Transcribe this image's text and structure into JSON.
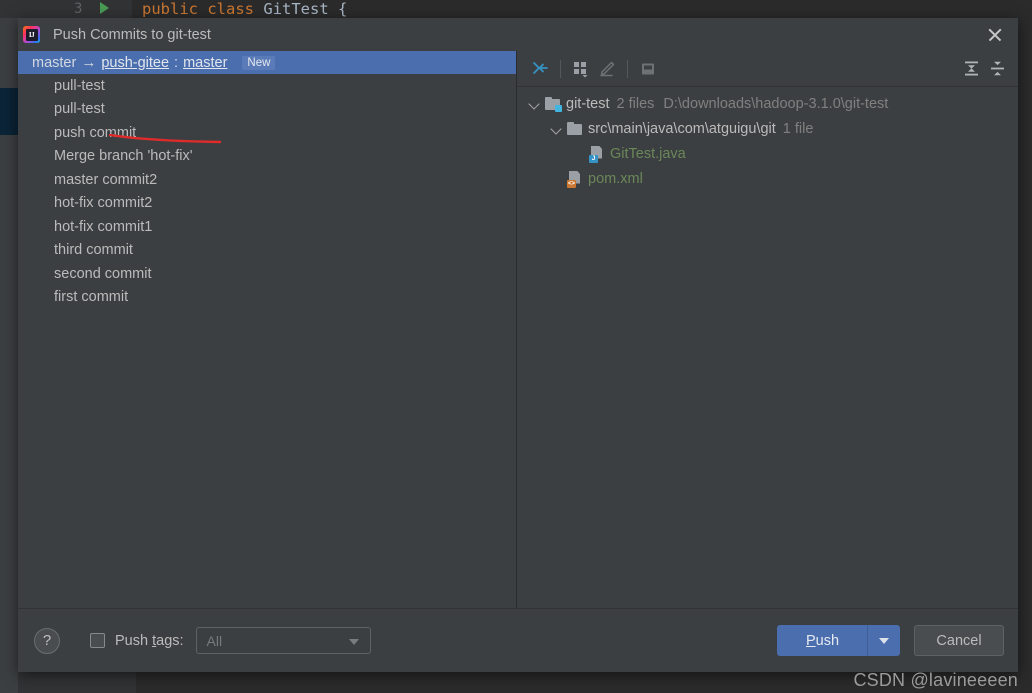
{
  "background": {
    "code_line": {
      "line_number": "3",
      "keyword1": "public",
      "keyword2": "class",
      "class_name": "GitTest",
      "brace": "{"
    }
  },
  "dialog": {
    "title": "Push Commits to git-test",
    "app_icon_text": "IJ",
    "close_label": "×"
  },
  "commits_pane": {
    "branch_row": {
      "source": "master",
      "arrow": "→",
      "remote": "push-gitee",
      "separator": ":",
      "destination": "master",
      "badge": "New"
    },
    "commits": [
      {
        "message": "pull-test"
      },
      {
        "message": "pull-test"
      },
      {
        "message": "push commit"
      },
      {
        "message": "Merge branch 'hot-fix'"
      },
      {
        "message": "master commit2"
      },
      {
        "message": "hot-fix commit2"
      },
      {
        "message": "hot-fix commit1"
      },
      {
        "message": "third commit"
      },
      {
        "message": "second commit"
      },
      {
        "message": "first commit"
      }
    ]
  },
  "tree_pane": {
    "toolbar": [
      {
        "icon": "collapse-to-center-icon",
        "label": ""
      },
      {
        "icon": "group-by-icon",
        "label": ""
      },
      {
        "icon": "edit-source-icon",
        "label": ""
      },
      {
        "icon": "preview-pane-icon",
        "label": ""
      },
      {
        "icon": "expand-all-icon",
        "label": ""
      },
      {
        "icon": "collapse-all-icon",
        "label": ""
      }
    ],
    "tree": [
      {
        "name": "git-test",
        "meta": "2 files",
        "path": "D:\\downloads\\hadoop-3.1.0\\git-test",
        "icon": "module-folder-icon",
        "expanded": true
      },
      {
        "name": "src\\main\\java\\com\\atguigu\\git",
        "meta": "1 file",
        "path": "",
        "icon": "folder-icon",
        "expanded": true
      },
      {
        "name": "GitTest.java",
        "meta": "",
        "path": "",
        "icon": "java-file-icon",
        "status": "added"
      },
      {
        "name": "pom.xml",
        "meta": "",
        "path": "",
        "icon": "xml-file-icon",
        "status": "added"
      }
    ]
  },
  "footer": {
    "help_label": "?",
    "push_tags_checked": false,
    "push_tags_label_pre": "Push ",
    "push_tags_mnemonic": "t",
    "push_tags_label_post": "ags:",
    "tags_select_value": "All",
    "push_mnemonic": "P",
    "push_label_rest": "ush",
    "push_dropdown_icon": "chevron-down-icon",
    "cancel_label": "Cancel"
  },
  "watermark": {
    "text": "CSDN @lavineeeen"
  },
  "colors": {
    "dialog_bg": "#3c3f41",
    "selection_blue": "#4b6eaf",
    "added_green": "#6a8759",
    "muted_text": "#808080",
    "primary_text": "#bbbbbb",
    "annotation_red": "#e02b2b",
    "editor_bg": "#2b2b2b"
  }
}
